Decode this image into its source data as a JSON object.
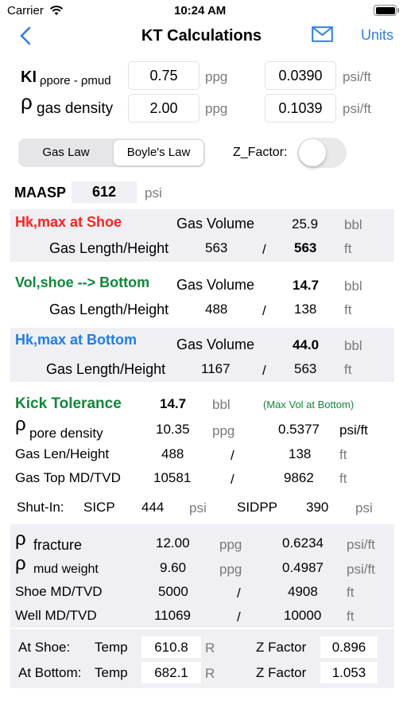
{
  "status": {
    "carrier": "Carrier",
    "time": "10:24 AM"
  },
  "nav": {
    "title": "KT Calculations",
    "units": "Units"
  },
  "inputs": {
    "ki": {
      "label_main": "KI",
      "label_sub": "ρpore - ρmud",
      "value1": "0.75",
      "unit1": "ppg",
      "value2": "0.0390",
      "unit2": "psi/ft"
    },
    "gas_density": {
      "label_main": "ρ",
      "label_sub": "gas density",
      "value1": "2.00",
      "unit1": "ppg",
      "value2": "0.1039",
      "unit2": "psi/ft"
    }
  },
  "segment": {
    "gas_law": "Gas Law",
    "boyles_law": "Boyle's Law",
    "selected": "Boyle's Law"
  },
  "zfactor_toggle": {
    "label": "Z_Factor:",
    "on": false
  },
  "maasp": {
    "label": "MAASP",
    "value": "612",
    "unit": "psi"
  },
  "hk_shoe": {
    "title": "Hk,max at Shoe",
    "gas_volume_label": "Gas Volume",
    "gas_volume": "25.9",
    "gas_volume_unit": "bbl",
    "gas_length_label": "Gas Length/Height",
    "length": "563",
    "slash": "/",
    "height": "563",
    "height_unit": "ft"
  },
  "vol_shoe_bottom": {
    "title": "Vol,shoe --> Bottom",
    "gas_volume_label": "Gas Volume",
    "gas_volume": "14.7",
    "gas_volume_unit": "bbl",
    "gas_length_label": "Gas Length/Height",
    "length": "488",
    "slash": "/",
    "height": "138",
    "height_unit": "ft"
  },
  "hk_bottom": {
    "title": "Hk,max at Bottom",
    "gas_volume_label": "Gas Volume",
    "gas_volume": "44.0",
    "gas_volume_unit": "bbl",
    "gas_length_label": "Gas Length/Height",
    "length": "1167",
    "slash": "/",
    "height": "563",
    "height_unit": "ft"
  },
  "kick_tolerance": {
    "label": "Kick Tolerance",
    "value": "14.7",
    "unit": "bbl",
    "note": "(Max Vol at Bottom)",
    "pore_rho": "ρ",
    "pore_label": "pore density",
    "pore_ppg": "10.35",
    "pore_ppg_unit": "ppg",
    "pore_psift": "0.5377",
    "pore_psift_unit": "psi/ft",
    "len_label": "Gas Len/Height",
    "len": "488",
    "len_slash": "/",
    "height": "138",
    "height_unit": "ft",
    "top_label": "Gas Top MD/TVD",
    "top_md": "10581",
    "top_slash": "/",
    "top_tvd": "9862",
    "top_unit": "ft"
  },
  "shut_in": {
    "label": "Shut-In:",
    "sicp_label": "SICP",
    "sicp": "444",
    "sicp_unit": "psi",
    "sidpp_label": "SIDPP",
    "sidpp": "390",
    "sidpp_unit": "psi"
  },
  "well": {
    "fracture_rho": "ρ",
    "fracture_label": "fracture",
    "fracture_ppg": "12.00",
    "fracture_ppg_unit": "ppg",
    "fracture_psift": "0.6234",
    "fracture_psift_unit": "psi/ft",
    "mud_rho": "ρ",
    "mud_label": "mud weight",
    "mud_ppg": "9.60",
    "mud_ppg_unit": "ppg",
    "mud_psift": "0.4987",
    "mud_psift_unit": "psi/ft",
    "shoe_label": "Shoe MD/TVD",
    "shoe_md": "5000",
    "shoe_slash": "/",
    "shoe_tvd": "4908",
    "shoe_unit": "ft",
    "well_label": "Well MD/TVD",
    "well_md": "11069",
    "well_slash": "/",
    "well_tvd": "10000",
    "well_unit": "ft"
  },
  "temps": {
    "shoe_label": "At Shoe:",
    "shoe_temp_label": "Temp",
    "shoe_temp": "610.8",
    "shoe_temp_unit": "R",
    "shoe_z_label": "Z Factor",
    "shoe_z": "0.896",
    "bottom_label": "At Bottom:",
    "bottom_temp_label": "Temp",
    "bottom_temp": "682.1",
    "bottom_temp_unit": "R",
    "bottom_z_label": "Z Factor",
    "bottom_z": "1.053"
  }
}
